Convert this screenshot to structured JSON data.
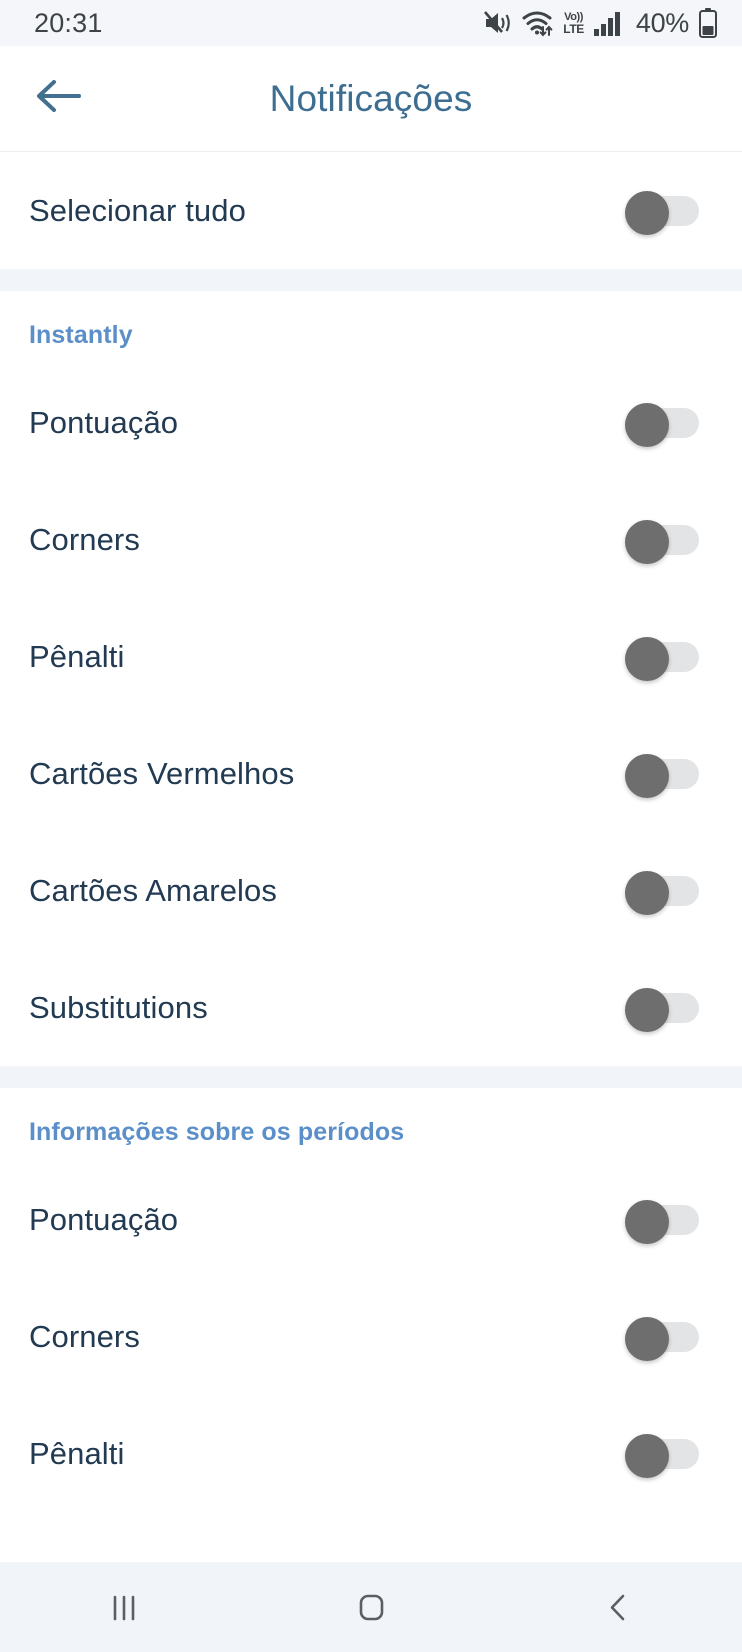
{
  "status_bar": {
    "clock": "20:31",
    "battery_percent": "40%",
    "icons": [
      "mute-vibrate-icon",
      "wifi-icon",
      "volte-icon",
      "signal-bars-icon",
      "battery-icon"
    ],
    "volte_top": "Vo))",
    "volte_bottom": "LTE"
  },
  "header": {
    "back_icon": "back-arrow-icon",
    "title": "Notificações"
  },
  "colors": {
    "header_title": "#3d6e92",
    "section_title": "#5b8fc9",
    "row_label": "#223a52",
    "toggle_thumb_off": "#6e6e6e",
    "toggle_track_off": "#e2e4e6",
    "status_bar_bg": "#f4f6f9",
    "nav_bar_bg": "#f1f4f8",
    "divider_band": "#f1f4f8"
  },
  "select_all": {
    "label": "Selecionar tudo",
    "toggle_state": "off"
  },
  "sections": [
    {
      "title": "Instantly",
      "rows": [
        {
          "label": "Pontuação",
          "toggle_state": "off"
        },
        {
          "label": "Corners",
          "toggle_state": "off"
        },
        {
          "label": "Pênalti",
          "toggle_state": "off"
        },
        {
          "label": "Cartões Vermelhos",
          "toggle_state": "off"
        },
        {
          "label": "Cartões Amarelos",
          "toggle_state": "off"
        },
        {
          "label": "Substitutions",
          "toggle_state": "off"
        }
      ]
    },
    {
      "title": "Informações sobre os períodos",
      "rows": [
        {
          "label": "Pontuação",
          "toggle_state": "off"
        },
        {
          "label": "Corners",
          "toggle_state": "off"
        },
        {
          "label": "Pênalti",
          "toggle_state": "off"
        }
      ]
    }
  ],
  "nav_bar": {
    "recents_label": "recents-icon",
    "home_label": "home-icon",
    "back_label": "back-icon"
  }
}
